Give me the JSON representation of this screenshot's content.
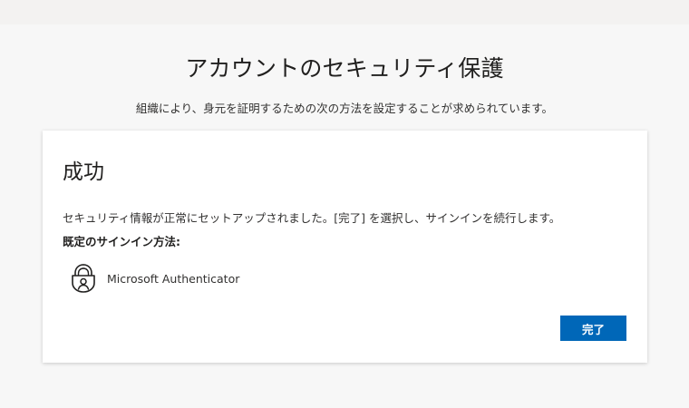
{
  "header": {
    "title": "アカウントのセキュリティ保護",
    "subtitle": "組織により、身元を証明するための次の方法を設定することが求められています。"
  },
  "card": {
    "title": "成功",
    "message": "セキュリティ情報が正常にセットアップされました。[完了] を選択し、サインインを続行します。",
    "default_method_label": "既定のサインイン方法:",
    "default_method": {
      "icon": "authenticator-lock-icon",
      "name": "Microsoft Authenticator"
    },
    "done_button_label": "完了"
  },
  "colors": {
    "page_background": "#f7f7f7",
    "card_background": "#ffffff",
    "accent": "#0067b8"
  }
}
